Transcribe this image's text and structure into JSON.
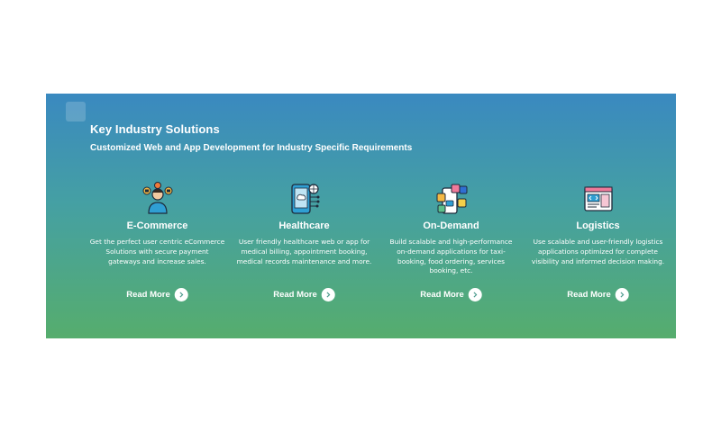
{
  "section": {
    "title": "Key Industry Solutions",
    "subtitle": "Customized Web and App Development for Industry Specific Requirements",
    "colors": {
      "gradient_top": "#3a89c0",
      "gradient_bottom": "#56ad6d",
      "text": "#ffffff"
    }
  },
  "cards": [
    {
      "title": "E-Commerce",
      "description": "Get the perfect user centric eCommerce Solutions with secure payment gateways and increase sales.",
      "cta": "Read More",
      "icon": "ecommerce-user-icon"
    },
    {
      "title": "Healthcare",
      "description": "User friendly healthcare web or app for medical billing, appointment booking, medical records maintenance and more.",
      "cta": "Read More",
      "icon": "healthcare-tablet-icon"
    },
    {
      "title": "On-Demand",
      "description": "Build scalable and high-performance on-demand applications for taxi-booking, food ordering, services booking, etc.",
      "cta": "Read More",
      "icon": "on-demand-phone-icon"
    },
    {
      "title": "Logistics",
      "description": "Use scalable and user-friendly logistics applications optimized for complete visibility and informed decision making.",
      "cta": "Read More",
      "icon": "logistics-browser-icon"
    }
  ]
}
